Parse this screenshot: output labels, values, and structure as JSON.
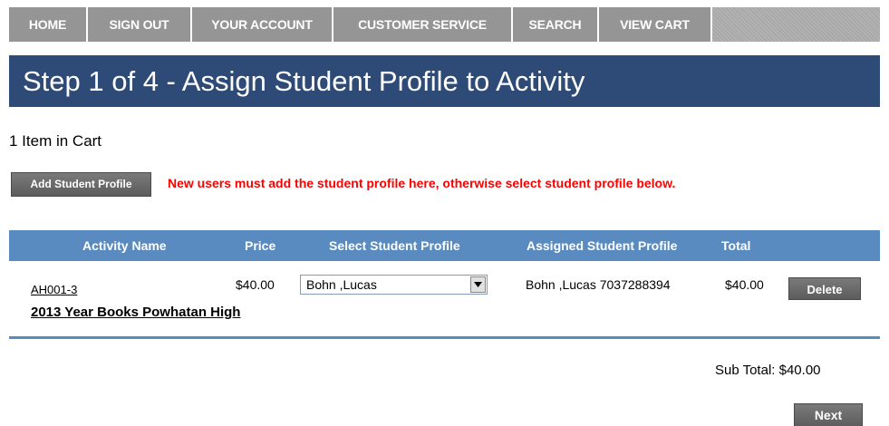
{
  "nav": {
    "items": [
      {
        "label": "HOME"
      },
      {
        "label": "SIGN OUT"
      },
      {
        "label": "YOUR ACCOUNT"
      },
      {
        "label": "CUSTOMER SERVICE"
      },
      {
        "label": "SEARCH"
      },
      {
        "label": "VIEW CART"
      }
    ]
  },
  "page": {
    "title": "Step 1 of 4 - Assign Student Profile to Activity",
    "cart_count": "1 Item in Cart",
    "add_profile_label": "Add Student Profile",
    "notice": "New users must add the student profile here, otherwise select student profile below."
  },
  "table": {
    "headers": {
      "activity_name": "Activity Name",
      "price": "Price",
      "select_profile": "Select Student Profile",
      "assigned_profile": "Assigned Student Profile",
      "total": "Total"
    },
    "rows": [
      {
        "code": "AH001-3",
        "title": "2013 Year Books Powhatan High",
        "price": "$40.00",
        "selected_profile": "Bohn ,Lucas",
        "assigned": "Bohn ,Lucas 7037288394",
        "total": "$40.00",
        "delete_label": "Delete"
      }
    ]
  },
  "summary": {
    "subtotal_label": "Sub Total:",
    "subtotal_value": "$40.00",
    "next_label": "Next"
  }
}
